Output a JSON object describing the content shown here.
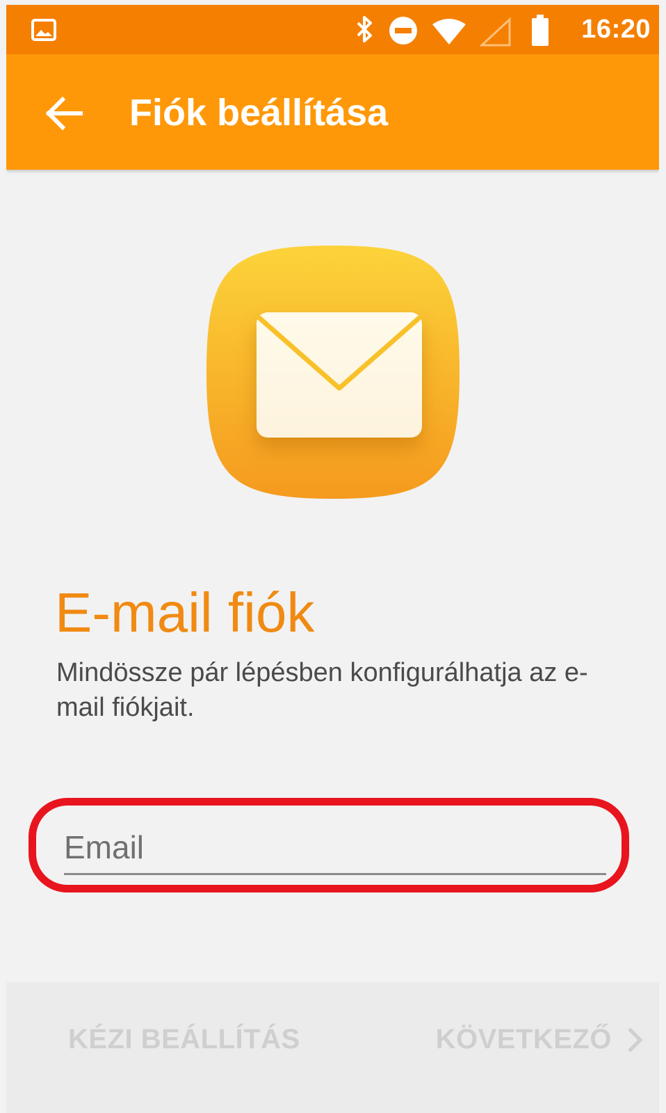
{
  "status_bar": {
    "time": "16:20",
    "icons": [
      "gallery-icon",
      "bluetooth-icon",
      "do-not-disturb-icon",
      "wifi-icon",
      "signal-icon",
      "battery-icon"
    ]
  },
  "app_bar": {
    "title": "Fiók beállítása",
    "back_icon": "arrow-left-icon"
  },
  "hero": {
    "icon": "mail-app-icon"
  },
  "main": {
    "heading": "E-mail fiók",
    "subtitle": "Mindössze pár lépésben konfigurálhatja az e-mail fiókjait."
  },
  "email_field": {
    "placeholder": "Email",
    "value": ""
  },
  "bottom_bar": {
    "manual_label": "KÉZI BEÁLLÍTÁS",
    "next_label": "KÖVETKEZŐ"
  },
  "colors": {
    "status_bar": "#f57f00",
    "app_bar": "#ff9809",
    "heading": "#f08a12",
    "highlight": "#e8141e"
  }
}
